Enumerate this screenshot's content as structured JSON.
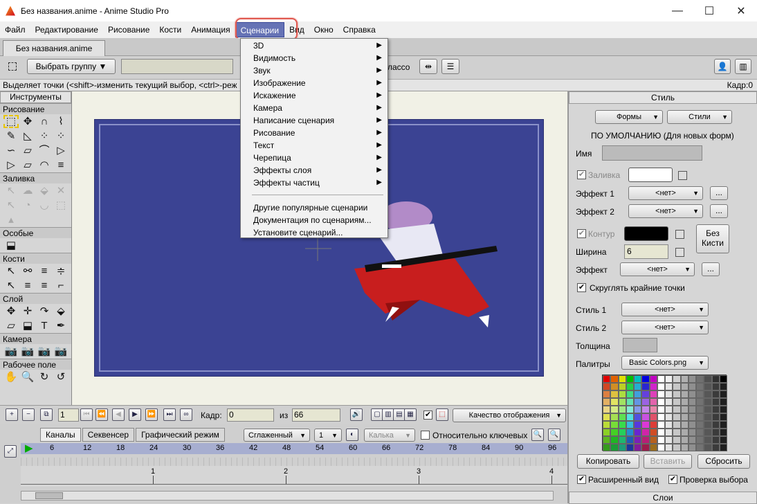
{
  "window": {
    "title": "Без названия.anime - Anime Studio Pro",
    "minimize": "—",
    "maximize": "☐",
    "close": "✕"
  },
  "menu": [
    "Файл",
    "Редактирование",
    "Рисование",
    "Кости",
    "Анимация",
    "Сценарии",
    "Вид",
    "Окно",
    "Справка"
  ],
  "active_menu_index": 5,
  "doc_tab": "Без названия.anime",
  "toolbar": {
    "select_group": "Выбрать группу",
    "lasso_suffix": "лассо"
  },
  "status": {
    "hint": "Выделяет точки (<shift>-изменить текущий выбор, <ctrl>-реж",
    "frame": "Кадр:0"
  },
  "tools": {
    "header": "Инструменты",
    "sections": [
      {
        "name": "Рисование",
        "icons": [
          "⬚",
          "✥",
          "∩",
          "⌇",
          "✎",
          "◺",
          "⁘",
          "⁘",
          "∽",
          "▱",
          "⌒",
          "▷",
          "▷",
          "▱",
          "◠",
          "≡"
        ]
      },
      {
        "name": "Заливка",
        "icons": [
          "↖",
          "☁",
          "⬙",
          "✕",
          "↖",
          "◔",
          "◡",
          "⬚",
          "▴"
        ]
      },
      {
        "name": "Особые",
        "icons": [
          "⬓"
        ]
      },
      {
        "name": "Кости",
        "icons": [
          "↖",
          "⚯",
          "≡",
          "≑",
          "↖",
          "≡",
          "≡",
          "⌐"
        ]
      },
      {
        "name": "Слой",
        "icons": [
          "✥",
          "✛",
          "↷",
          "⬙",
          "▱",
          "⬓",
          "T",
          "✒"
        ]
      },
      {
        "name": "Камера",
        "icons": [
          "📷",
          "📷",
          "📷",
          "📷"
        ]
      },
      {
        "name": "Рабочее поле",
        "icons": [
          "✋",
          "🔍",
          "↻",
          "↺"
        ]
      }
    ]
  },
  "scripts_menu": {
    "submenus": [
      "3D",
      "Видимость",
      "Звук",
      "Изображение",
      "Искажение",
      "Камера",
      "Написание сценария",
      "Рисование",
      "Текст",
      "Черепица",
      "Эффекты слоя",
      "Эффекты частиц"
    ],
    "commands": [
      "Другие популярные сценарии",
      "Документация по сценариям...",
      "Установите сценарий..."
    ]
  },
  "style_panel": {
    "header": "Стиль",
    "shapes_btn": "Формы",
    "styles_btn": "Стили",
    "default_label": "ПО УМОЛЧАНИЮ (Для новых форм)",
    "name_label": "Имя",
    "fill_label": "Заливка",
    "effect1_label": "Эффект 1",
    "effect2_label": "Эффект 2",
    "none": "<нет>",
    "dots": "...",
    "outline_label": "Контур",
    "width_label": "Ширина",
    "width_value": "6",
    "effect_label": "Эффект",
    "no_brush": "Без Кисти",
    "round_caps": "Скруглять крайние точки",
    "style1_label": "Стиль 1",
    "style2_label": "Стиль 2",
    "thickness_label": "Толщина",
    "palettes_label": "Палитры",
    "palette_name": "Basic Colors.png",
    "copy_btn": "Копировать",
    "paste_btn": "Вставить",
    "reset_btn": "Сбросить",
    "expanded_view": "Расширенный вид",
    "check_selection": "Проверка выбора",
    "layers_header": "Слои",
    "colors": {
      "fill": "#ffffff",
      "outline": "#000000"
    }
  },
  "timeline_controls": {
    "start_frame": "1",
    "frame_label": "Кадр:",
    "frame_value": "0",
    "of_label": "из",
    "total": "66",
    "quality": "Качество отображения"
  },
  "timeline": {
    "tabs": [
      "Каналы",
      "Секвенсер",
      "Графический режим"
    ],
    "interp": "Сглаженный",
    "interp_value": "1",
    "keyframe": "Калька",
    "relative": "Относительно ключевых",
    "ruler": [
      "6",
      "12",
      "18",
      "24",
      "30",
      "36",
      "42",
      "48",
      "54",
      "60",
      "66",
      "72",
      "78",
      "84",
      "90",
      "96"
    ],
    "seconds": [
      "1",
      "2",
      "3",
      "4"
    ]
  },
  "palette_colors": [
    "#e00000",
    "#e06000",
    "#e0e000",
    "#00c000",
    "#00c0c0",
    "#0000e0",
    "#c000c0",
    "#ffffff",
    "#f0f0f0",
    "#d0d0d0",
    "#b0b0b0",
    "#909090",
    "#707070",
    "#505050",
    "#303030",
    "#000000"
  ]
}
